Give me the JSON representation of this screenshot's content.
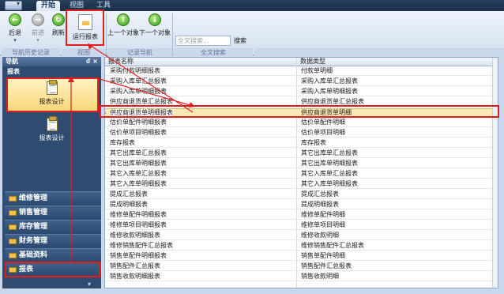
{
  "tabs": [
    "开始",
    "视图",
    "工具"
  ],
  "ribbon": {
    "back": "后退",
    "forward": "前进",
    "refresh": "刷新",
    "run_report": "运行报表",
    "prev_object": "上一个对象",
    "next_object": "下一个对象",
    "search_placeholder": "全文搜索...",
    "search_button": "搜索",
    "group_history": "导航历史记录",
    "group_view": "视图",
    "group_record_nav": "记录导航",
    "group_fulltext": "全文搜索"
  },
  "nav": {
    "title": "导航",
    "pin": "ᵭ",
    "close": "×",
    "subtitle": "报表",
    "items": [
      "报表设计",
      "报表设计"
    ],
    "categories": [
      "维修管理",
      "销售管理",
      "库存管理",
      "财务管理",
      "基础资料",
      "报表"
    ],
    "chevron": "▾"
  },
  "grid": {
    "columns": [
      "报表名称",
      "数据类型"
    ],
    "rows": [
      [
        "采购付款明细报表",
        "付款单明细"
      ],
      [
        "采购入库单汇总报表",
        "采购入库单汇总报表"
      ],
      [
        "采购入库单明细报表",
        "采购入库单明细报表"
      ],
      [
        "供应商退货单汇总报表",
        "供应商退货单汇总报表"
      ],
      [
        "供应商退货单明细报表",
        "供应商退货单明细"
      ],
      [
        "估价单配件明细报表",
        "估价单配件明细"
      ],
      [
        "估价单项目明细报表",
        "估价单项目明细"
      ],
      [
        "库存报表",
        "库存报表"
      ],
      [
        "其它出库单汇总报表",
        "其它出库单汇总报表"
      ],
      [
        "其它出库单明细报表",
        "其它出库单明细报表"
      ],
      [
        "其它入库单汇总报表",
        "其它入库单汇总报表"
      ],
      [
        "其它入库单明细报表",
        "其它入库单明细报表"
      ],
      [
        "提成汇总报表",
        "提成汇总报表"
      ],
      [
        "提成明细报表",
        "提成明细报表"
      ],
      [
        "维修单配件明细报表",
        "维修单配件明细"
      ],
      [
        "维修单项目明细报表",
        "维修单项目明细"
      ],
      [
        "维修收款明细报表",
        "维修收款明细"
      ],
      [
        "维修销售配件汇总报表",
        "维修销售配件汇总报表"
      ],
      [
        "销售单配件明细报表",
        "销售单配件明细"
      ],
      [
        "销售配件汇总报表",
        "销售配件汇总报表"
      ],
      [
        "销售收款明细报表",
        "销售收款明细"
      ]
    ],
    "selected_row_marker": "▶"
  },
  "colors": {
    "annotation_red": "#e21d1d",
    "selection": "#fce9b5",
    "nav_bg": "#2f4b70"
  }
}
